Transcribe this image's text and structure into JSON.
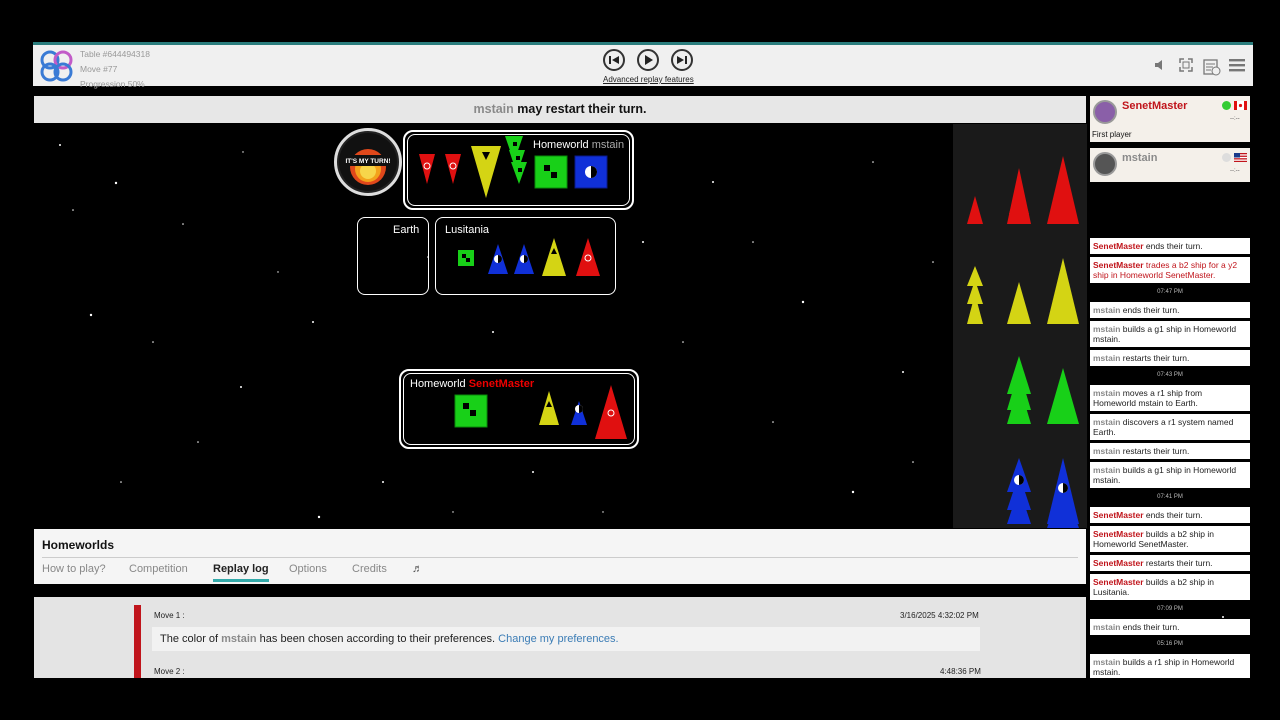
{
  "table": {
    "id": "Table #644494318",
    "move": "Move #77",
    "progression": "Progression 50%"
  },
  "replay": {
    "advanced": "Advanced replay features"
  },
  "status": {
    "player": "mstain",
    "text": " may restart their turn."
  },
  "badge": {
    "top": "BOARDGAME ARENA",
    "main": "IT'S MY TURN!",
    "bottom": "TURN TOKEN"
  },
  "systems": {
    "home1_label": "Homeworld",
    "home1_player": "mstain",
    "earth": "Earth",
    "lusitania": "Lusitania",
    "home2_label": "Homeworld",
    "home2_player": "SenetMaster"
  },
  "game": {
    "title": "Homeworlds",
    "tabs": [
      "How to play?",
      "Competition",
      "Replay log",
      "Options",
      "Credits"
    ],
    "active_tab": "Replay log",
    "music_icon": "music-icon"
  },
  "replaylog": {
    "move1_label": "Move 1 :",
    "move1_time": "3/16/2025 4:32:02 PM",
    "msg_pre": "The color of ",
    "msg_player": "mstain",
    "msg_post": " has been chosen according to their preferences. ",
    "msg_link": "Change my preferences.",
    "move2_label": "Move 2 :",
    "move2_time": "4:48:36 PM"
  },
  "players": [
    {
      "name": "SenetMaster",
      "sub": "First player",
      "score": "--:--",
      "name_color": "#c0141b"
    },
    {
      "name": "mstain",
      "sub": "",
      "score": "--:--",
      "name_color": "#8a8a8a"
    }
  ],
  "chat": [
    {
      "type": "entry",
      "player": "SenetMaster",
      "pcolor": "r",
      "text": " ends their turn."
    },
    {
      "type": "entry",
      "player": "SenetMaster",
      "pcolor": "r",
      "text": " trades a b2 ship for a y2 ship in Homeworld SenetMaster.",
      "red": true
    },
    {
      "type": "time",
      "text": "07:47 PM"
    },
    {
      "type": "entry",
      "player": "mstain",
      "pcolor": "g",
      "text": " ends their turn."
    },
    {
      "type": "entry",
      "player": "mstain",
      "pcolor": "g",
      "text": " builds a g1 ship in Homeworld mstain."
    },
    {
      "type": "entry",
      "player": "mstain",
      "pcolor": "g",
      "text": " restarts their turn."
    },
    {
      "type": "time",
      "text": "07:43 PM"
    },
    {
      "type": "entry",
      "player": "mstain",
      "pcolor": "g",
      "text": " moves a r1 ship from Homeworld mstain to Earth."
    },
    {
      "type": "entry",
      "player": "mstain",
      "pcolor": "g",
      "text": " discovers a r1 system named Earth."
    },
    {
      "type": "entry",
      "player": "mstain",
      "pcolor": "g",
      "text": " restarts their turn."
    },
    {
      "type": "entry",
      "player": "mstain",
      "pcolor": "g",
      "text": " builds a g1 ship in Homeworld mstain."
    },
    {
      "type": "time",
      "text": "07:41 PM"
    },
    {
      "type": "entry",
      "player": "SenetMaster",
      "pcolor": "r",
      "text": " ends their turn."
    },
    {
      "type": "entry",
      "player": "SenetMaster",
      "pcolor": "r",
      "text": " builds a b2 ship in Homeworld SenetMaster."
    },
    {
      "type": "entry",
      "player": "SenetMaster",
      "pcolor": "r",
      "text": " restarts their turn."
    },
    {
      "type": "entry",
      "player": "SenetMaster",
      "pcolor": "r",
      "text": " builds a b2 ship in Lusitania."
    },
    {
      "type": "time",
      "text": "07:09 PM"
    },
    {
      "type": "entry",
      "player": "mstain",
      "pcolor": "g",
      "text": " ends their turn."
    },
    {
      "type": "time",
      "text": "05:16 PM"
    },
    {
      "type": "entry",
      "player": "mstain",
      "pcolor": "g",
      "text": " builds a r1 ship in Homeworld mstain."
    }
  ],
  "colors": {
    "red": "#e01010",
    "yellow": "#d4d414",
    "green": "#18d018",
    "blue": "#1030d8",
    "accent": "#2a7d7d"
  },
  "icons": [
    "logo-icon",
    "prev-icon",
    "play-icon",
    "next-icon",
    "mute-icon",
    "fullscreen-icon",
    "notes-icon",
    "menu-icon"
  ]
}
